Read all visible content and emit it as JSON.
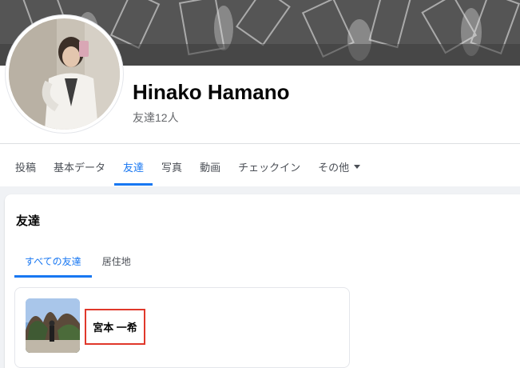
{
  "profile": {
    "name": "Hinako Hamano",
    "friend_count": "友達12人"
  },
  "tabs": [
    {
      "label": "投稿"
    },
    {
      "label": "基本データ"
    },
    {
      "label": "友達",
      "active": true
    },
    {
      "label": "写真"
    },
    {
      "label": "動画"
    },
    {
      "label": "チェックイン"
    },
    {
      "label": "その他"
    }
  ],
  "friends_section": {
    "title": "友達",
    "subtabs": [
      {
        "label": "すべての友達",
        "active": true
      },
      {
        "label": "居住地"
      }
    ],
    "friends": [
      {
        "name": "宮本 一希"
      }
    ]
  },
  "colors": {
    "accent": "#1877f2",
    "highlight_box": "#e0382b",
    "background": "#f0f2f5"
  },
  "icons": {
    "more_dropdown": "caret-down-icon"
  }
}
